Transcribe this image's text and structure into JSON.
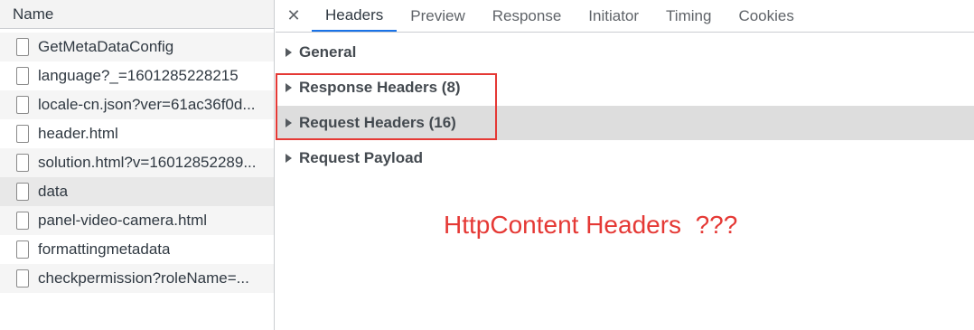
{
  "network_list": {
    "header": "Name",
    "requests": [
      {
        "name": "GetMetaDataConfig"
      },
      {
        "name": "language?_=1601285228215"
      },
      {
        "name": "locale-cn.json?ver=61ac36f0d..."
      },
      {
        "name": "header.html"
      },
      {
        "name": "solution.html?v=16012852289..."
      },
      {
        "name": "data"
      },
      {
        "name": "panel-video-camera.html"
      },
      {
        "name": "formattingmetadata"
      },
      {
        "name": "checkpermission?roleName=..."
      }
    ]
  },
  "detail": {
    "close_glyph": "✕",
    "tabs": [
      {
        "label": "Headers",
        "active": true
      },
      {
        "label": "Preview"
      },
      {
        "label": "Response"
      },
      {
        "label": "Initiator"
      },
      {
        "label": "Timing"
      },
      {
        "label": "Cookies"
      }
    ],
    "sections": [
      {
        "label": "General"
      },
      {
        "label": "Response Headers (8)"
      },
      {
        "label": "Request Headers (16)"
      },
      {
        "label": "Request Payload"
      }
    ]
  },
  "annotation": {
    "text": "HttpContent Headers  ???",
    "color": "#e53935"
  },
  "colors": {
    "accent": "#1a73e8",
    "annotation_red": "#e53935"
  }
}
